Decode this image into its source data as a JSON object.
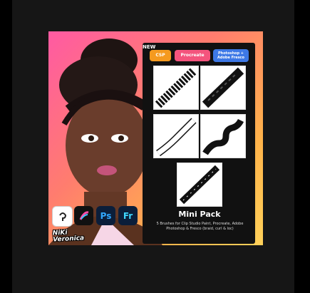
{
  "badge": {
    "new": "NEW"
  },
  "chips": {
    "csp": "CSP",
    "procreate": "Procreate",
    "photoshop_fresco": "Photoshop + Adobe Fresco"
  },
  "pack": {
    "title": "Mini Pack",
    "description": "5 Brushes for Clip Studio Paint, Procreate, Adobe Photoshop & Fresco (braid, curl & loc)"
  },
  "apps": {
    "ps": "Ps",
    "fr": "Fr"
  },
  "icons": {
    "csp": "clip-studio-icon",
    "procreate": "procreate-icon",
    "ps": "photoshop-icon",
    "fr": "fresco-icon"
  },
  "logo": {
    "text": "NiKi Veronica"
  },
  "colors": {
    "csp_chip": "#f59a1f",
    "procreate_chip": "#f4547d",
    "adobe_chip": "#3d78e6"
  }
}
